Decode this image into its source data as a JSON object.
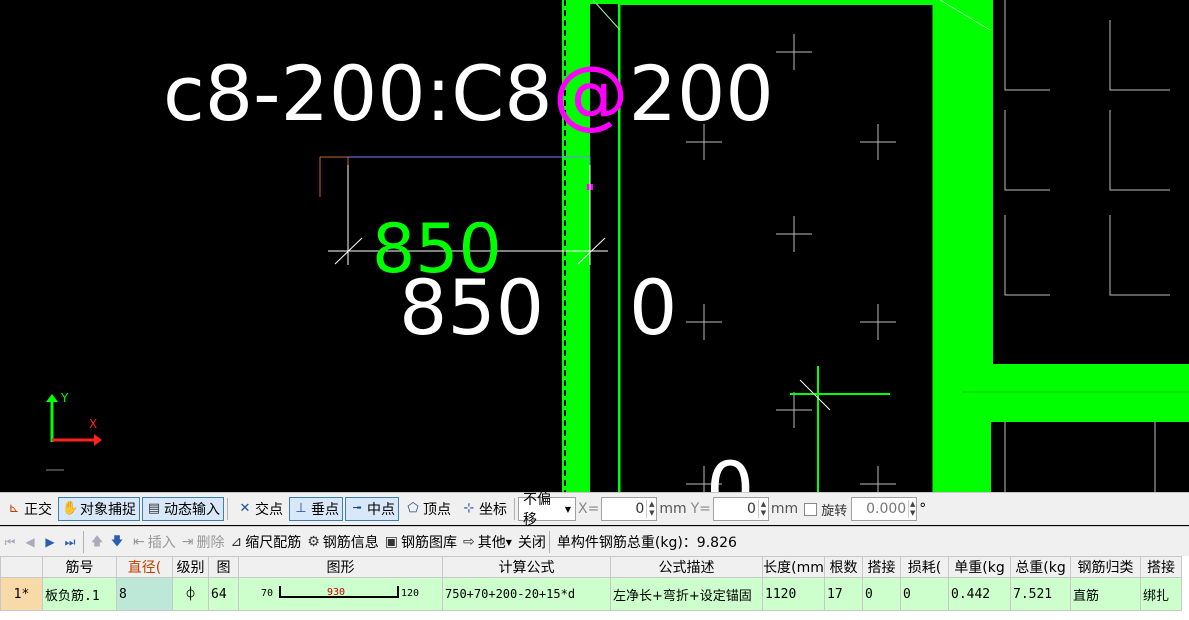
{
  "canvas": {
    "label_rebar": "c8-200:C8",
    "label_at": "@",
    "label_spacing": "200",
    "dim_green": "850",
    "dim_white": "850",
    "dim_zero": "0",
    "bottom_digit": "0",
    "axis_x": "X",
    "axis_y": "Y",
    "colors": {
      "background": "#000000",
      "wall": "#00ff00",
      "at_sign": "#ff00ff",
      "dim_green": "#00ff00"
    }
  },
  "toolbar1": {
    "ortho": "正交",
    "snap": "对象捕捉",
    "dyn_input": "动态输入",
    "intersection": "交点",
    "perpendicular": "垂点",
    "midpoint": "中点",
    "vertex": "顶点",
    "coordinate": "坐标",
    "offset_select": "不偏移",
    "x_label": "X=",
    "x_value": "0",
    "unit1": "mm",
    "y_label": "Y=",
    "y_value": "0",
    "unit2": "mm",
    "rotate_label": "旋转",
    "rotate_value": "0.000",
    "degree": "°"
  },
  "toolbar2": {
    "insert": "插入",
    "delete": "删除",
    "scale_rebar": "缩尺配筋",
    "rebar_info": "钢筋信息",
    "rebar_library": "钢筋图库",
    "other": "其他",
    "close": "关闭",
    "total_weight": "单构件钢筋总重(kg)：9.826"
  },
  "table": {
    "headers": [
      "筋号",
      "直径(",
      "级别",
      "图",
      "图形",
      "计算公式",
      "公式描述",
      "长度(mm",
      "根数",
      "搭接",
      "损耗(",
      "单重(kg",
      "总重(kg",
      "钢筋归类",
      "搭接"
    ],
    "row": {
      "row_no": "1*",
      "bar_no": "板负筋.1",
      "diameter": "8",
      "grade": "⌽",
      "shape_no": "64",
      "shape_left": "70",
      "shape_mid": "930",
      "shape_right": "120",
      "formula": "750+70+200-20+15*d",
      "description": "左净长+弯折+设定锚固",
      "length": "1120",
      "count": "17",
      "lap": "0",
      "loss": "0",
      "unit_weight": "0.442",
      "total_weight": "7.521",
      "category": "直筋",
      "lap_type": "绑扎"
    }
  }
}
